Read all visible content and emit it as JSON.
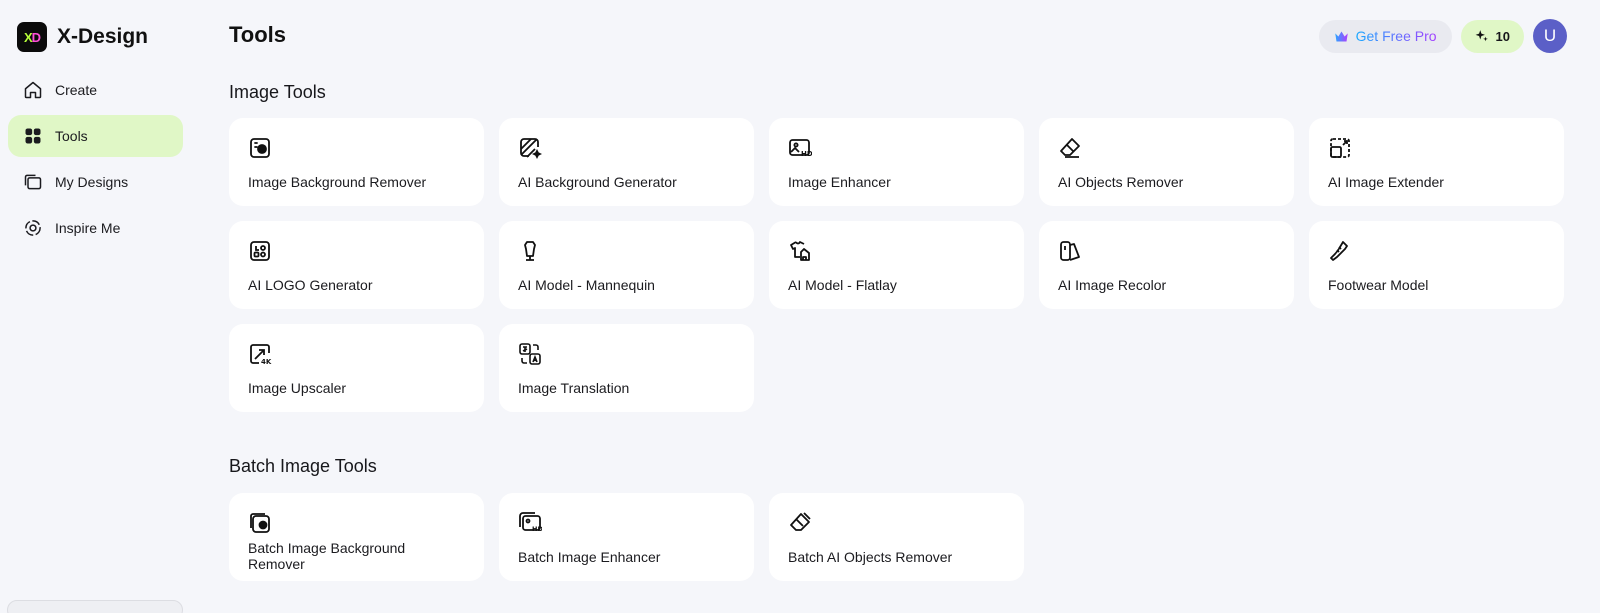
{
  "brand": {
    "logo_text_x": "X",
    "logo_text_d": "D",
    "name": "X-Design"
  },
  "nav": {
    "items": [
      {
        "label": "Create",
        "icon": "home-icon",
        "active": false
      },
      {
        "label": "Tools",
        "icon": "grid-icon",
        "active": true
      },
      {
        "label": "My Designs",
        "icon": "folders-icon",
        "active": false
      },
      {
        "label": "Inspire Me",
        "icon": "inspire-icon",
        "active": false
      }
    ]
  },
  "header": {
    "title": "Tools",
    "pro_label": "Get Free Pro",
    "credits": "10",
    "avatar_initial": "U"
  },
  "sections": {
    "image_tools": {
      "title": "Image Tools",
      "tools": [
        {
          "label": "Image Background Remover",
          "icon": "bg-remover-icon"
        },
        {
          "label": "AI Background Generator",
          "icon": "bg-generator-icon"
        },
        {
          "label": "Image Enhancer",
          "icon": "hd-image-icon"
        },
        {
          "label": "AI Objects Remover",
          "icon": "eraser-icon"
        },
        {
          "label": "AI Image Extender",
          "icon": "extend-icon"
        },
        {
          "label": "AI LOGO Generator",
          "icon": "logo-icon"
        },
        {
          "label": "AI Model - Mannequin",
          "icon": "mannequin-icon"
        },
        {
          "label": "AI Model - Flatlay",
          "icon": "flatlay-icon"
        },
        {
          "label": "AI Image Recolor",
          "icon": "recolor-icon"
        },
        {
          "label": "Footwear Model",
          "icon": "shoe-icon"
        },
        {
          "label": "Image Upscaler",
          "icon": "upscale-4k-icon"
        },
        {
          "label": "Image Translation",
          "icon": "translate-icon"
        }
      ]
    },
    "batch_tools": {
      "title": "Batch Image Tools",
      "tools": [
        {
          "label": "Batch Image Background Remover",
          "icon": "batch-bg-remover-icon"
        },
        {
          "label": "Batch Image Enhancer",
          "icon": "batch-hd-image-icon"
        },
        {
          "label": "Batch AI Objects Remover",
          "icon": "batch-eraser-icon"
        }
      ]
    }
  }
}
